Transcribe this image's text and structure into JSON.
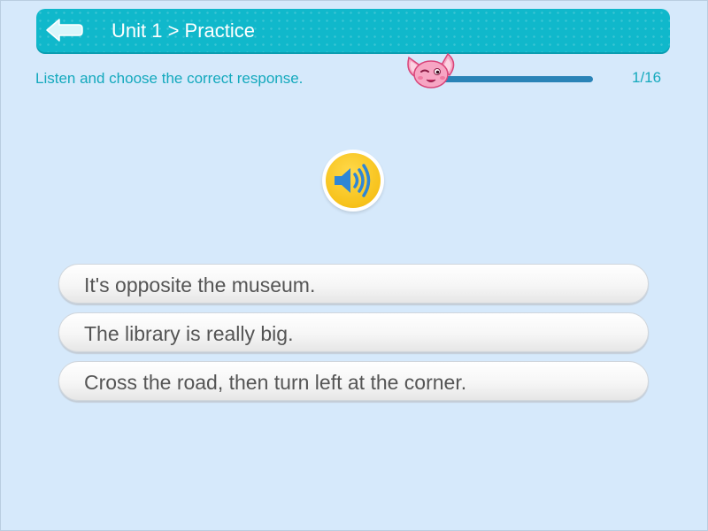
{
  "header": {
    "title": "Unit 1 > Practice",
    "back_icon": "back-arrow-icon",
    "color": "#10b8cb"
  },
  "instruction": "Listen and choose the correct response.",
  "progress": {
    "current": 1,
    "total": 16,
    "label": "1/16",
    "fraction": 0.0625,
    "mascot_icon": "pink-mascot-icon"
  },
  "audio": {
    "icon": "speaker-icon",
    "color": "#f7c21b"
  },
  "options": [
    {
      "label": "It's opposite the museum."
    },
    {
      "label": "The library is really big."
    },
    {
      "label": "Cross the road, then turn left at the corner."
    }
  ],
  "colors": {
    "background": "#d6e9fb",
    "accent_text": "#14a9bd",
    "progress": "#2a83b7"
  }
}
